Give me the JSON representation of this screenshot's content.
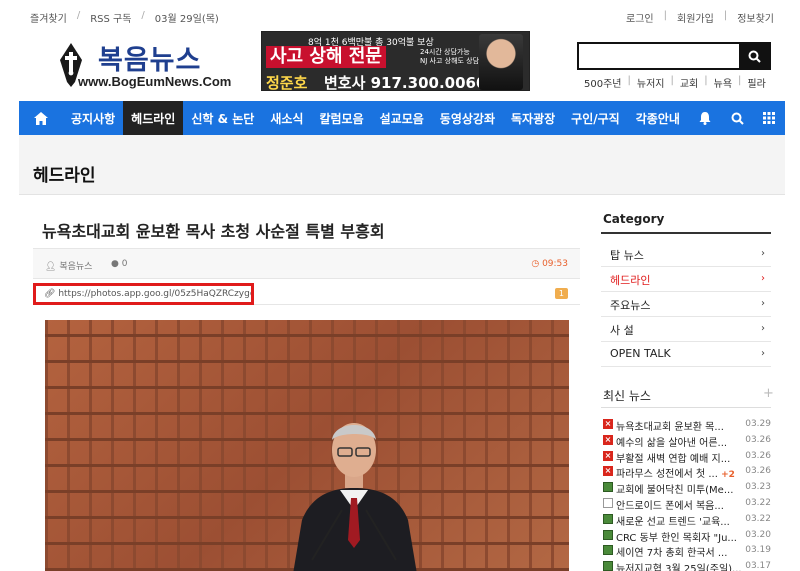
{
  "topbar": {
    "left": [
      "즐겨찾기",
      "RSS 구독",
      "03월 29일(목)"
    ],
    "right": [
      "로그인",
      "회원가입",
      "정보찾기"
    ]
  },
  "logo": {
    "title": "복음뉴스",
    "url": "www.BogEumNews.Com"
  },
  "banner": {
    "line1": "8억 1천 6백만불 총 30억불 보상",
    "headline": "사고 상해 전문",
    "side1": "24시간 상담가능",
    "side2": "NJ 사고 상해도 상담",
    "name": "정준호",
    "phone": "변호사 917.300.0060"
  },
  "search": {
    "placeholder": "",
    "icon": "search-icon"
  },
  "quick_links": [
    "500주년",
    "뉴저지",
    "교회",
    "뉴욕",
    "필라"
  ],
  "nav": {
    "items": [
      "공지사항",
      "헤드라인",
      "신학 & 논단",
      "새소식",
      "칼럼모음",
      "설교모음",
      "동영상강좌",
      "독자광장",
      "구인/구직",
      "각종안내"
    ],
    "active_index": 1,
    "color": "#1a73e0"
  },
  "page_title": "헤드라인",
  "article": {
    "title": "뉴욕초대교회 윤보환 목사 초청 사순절 특별 부흥회",
    "author": "복음뉴스",
    "comments": "0",
    "time": "09:53",
    "link": "https://photos.app.goo.gl/05z5HaQZRCzygctl3",
    "link_count": "1"
  },
  "sidebar": {
    "category_title": "Category",
    "categories": [
      "탑 뉴스",
      "헤드라인",
      "주요뉴스",
      "사 설",
      "OPEN TALK"
    ],
    "active_category": 1,
    "news_title": "최신 뉴스",
    "news": [
      {
        "title": "뉴욕초대교회 윤보환 목...",
        "date": "03.29",
        "icon": "red",
        "badge": ""
      },
      {
        "title": "예수의 삶을 살아낸 어른...",
        "date": "03.26",
        "icon": "red",
        "badge": ""
      },
      {
        "title": "부활절 새벽 연합 예배 지...",
        "date": "03.26",
        "icon": "red",
        "badge": ""
      },
      {
        "title": "파라무스 성전에서 첫 ...",
        "date": "03.26",
        "icon": "red",
        "badge": "+2"
      },
      {
        "title": "교회에 불어닥친 미투(Me...",
        "date": "03.23",
        "icon": "img",
        "badge": ""
      },
      {
        "title": "안드로이드 폰에서 복음...",
        "date": "03.22",
        "icon": "doc",
        "badge": ""
      },
      {
        "title": "새로운 선교 트렌드 '교육...",
        "date": "03.22",
        "icon": "img",
        "badge": ""
      },
      {
        "title": "CRC 동부 한인 목회자 \"Ju...",
        "date": "03.20",
        "icon": "img",
        "badge": ""
      },
      {
        "title": "세이연 7차 총회 한국서 ...",
        "date": "03.19",
        "icon": "img",
        "badge": ""
      },
      {
        "title": "뉴저지교협 3월 25일(주일)...",
        "date": "03.17",
        "icon": "img",
        "badge": ""
      }
    ]
  }
}
